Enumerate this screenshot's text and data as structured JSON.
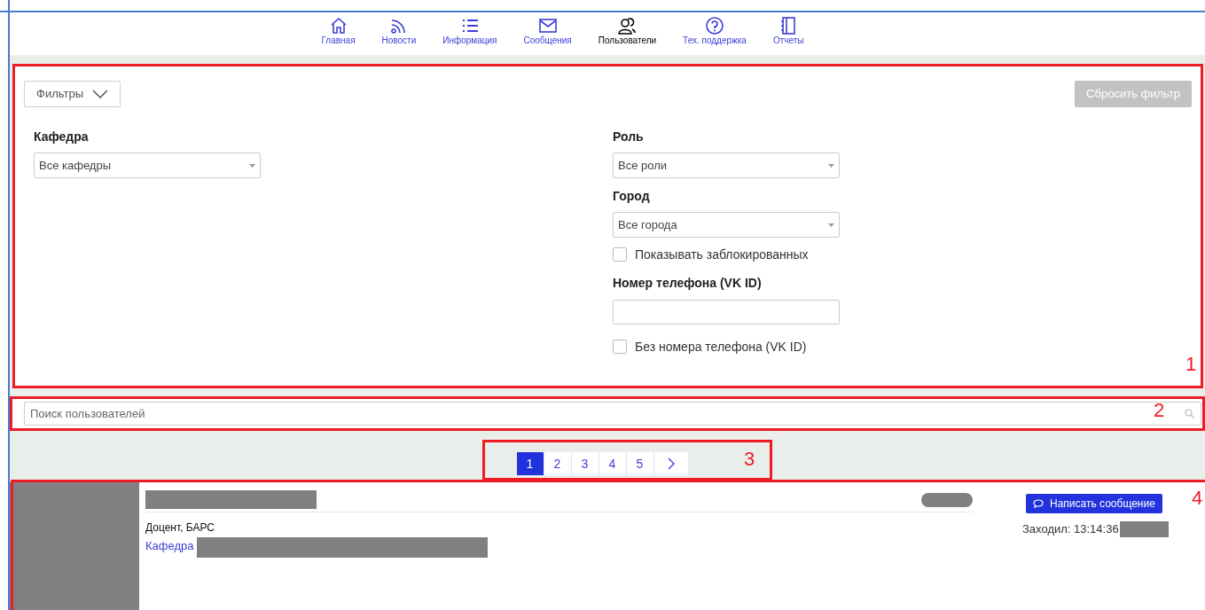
{
  "nav": [
    {
      "label": "Главная",
      "selected": false
    },
    {
      "label": "Новости",
      "selected": false
    },
    {
      "label": "Информация",
      "selected": false
    },
    {
      "label": "Сообщения",
      "selected": false
    },
    {
      "label": "Пользователи",
      "selected": true
    },
    {
      "label": "Тех. поддержка",
      "selected": false
    },
    {
      "label": "Отчеты",
      "selected": false
    }
  ],
  "filters": {
    "toggle": "Фильтры",
    "expanded": true,
    "reset": {
      "label": "Сбросить фильтр",
      "disabled": true
    },
    "left": [
      {
        "kind": "select",
        "label": "Кафедра",
        "value": "Все кафедры"
      }
    ],
    "right": [
      {
        "kind": "select",
        "label": "Роль",
        "value": "Все роли"
      },
      {
        "kind": "select",
        "label": "Город",
        "value": "Все города"
      },
      {
        "kind": "checkbox",
        "label": "Показывать заблокированных",
        "checked": false
      },
      {
        "kind": "input",
        "label": "Номер телефона (VK ID)"
      },
      {
        "kind": "checkbox",
        "label": "Без номера телефона (VK ID)",
        "checked": false
      }
    ]
  },
  "search": {
    "placeholder": "Поиск пользователей"
  },
  "pagination": {
    "pages": [
      {
        "label": "1",
        "selected": true
      },
      {
        "label": "2",
        "selected": false
      },
      {
        "label": "3",
        "selected": false
      },
      {
        "label": "4",
        "selected": false
      },
      {
        "label": "5",
        "selected": false
      }
    ]
  },
  "user": {
    "position": "Доцент, БАРС",
    "department_label": "Кафедра",
    "message_button": "Написать сообщение",
    "last_seen": "Заходил: 13:14:36"
  },
  "annotations": [
    "1",
    "2",
    "3",
    "4"
  ]
}
